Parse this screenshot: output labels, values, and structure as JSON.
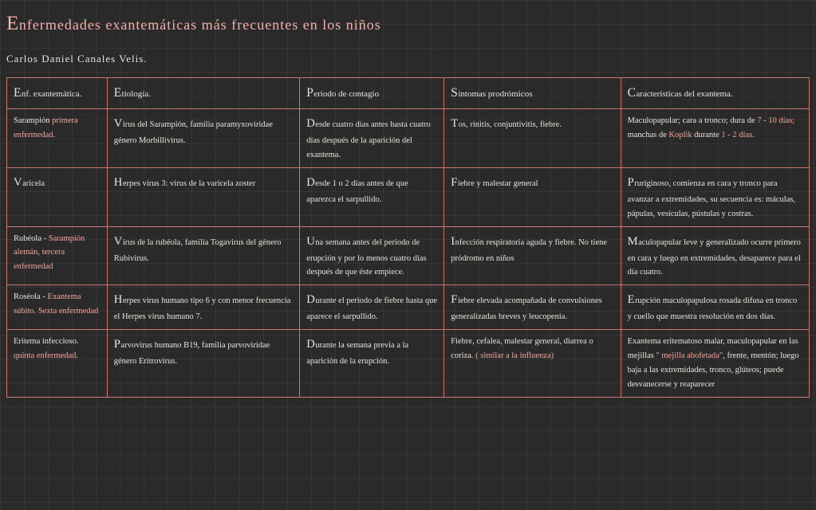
{
  "title": "Enfermedades exantemáticas más frecuentes en los niños",
  "author": "Carlos Daniel Canales Velis.",
  "headers": {
    "c0": "Enf. exantemática.",
    "c1": "Etiología.",
    "c2": "Periodo de contagio",
    "c3": "Síntomas prodrómicos",
    "c4": "Características del exantema."
  },
  "rows": [
    {
      "c0_a": "Sarampión ",
      "c0_b": "primera enfermedad.",
      "c1": "Virus del Sarampión, familia paramyxoviridae género Morbillivirus.",
      "c2": "Desde cuatro días antes hasta cuatro días después de la aparición del exantema.",
      "c3": "Tos, rinitis, conjuntivitis, fiebre.",
      "c4_a": "Maculopapular; cara a tronco; dura de ",
      "c4_b": "7 - 10 días; ",
      "c4_c": "manchas de ",
      "c4_d": "Koplik ",
      "c4_e": "durante ",
      "c4_f": "1 - 2 días."
    },
    {
      "c0": "Varicela",
      "c1": "Herpes virus 3: virus de la varicela zoster",
      "c2": "Desde 1 o 2 días antes de que aparezca el sarpullido.",
      "c3": "Fiebre y malestar general",
      "c4": "Pruriginoso, comienza en cara y tronco para avanzar a extremidades, su secuencia es: máculas, pápulas, vesículas, pústulas y costras."
    },
    {
      "c0_a": "Rubéola - ",
      "c0_b": "Sarampión alemán, tercera enfermedad",
      "c1": "Virus de la rubéola, familia Togavirus del género Rubivirus.",
      "c2": "Una semana antes del periodo de erupción y por lo menos cuatro días después de que éste empiece.",
      "c3": "Infección respiratoria aguda y fiebre. No tiene pródromo en niños",
      "c4": "Maculopapular leve y generalizado ocurre primero en cara y luego en extremidades, desaparece para el día cuatro."
    },
    {
      "c0_a": "Roséola - ",
      "c0_b": "Exantema súbito. Sexta enfermedad",
      "c1": "Herpes virus humano tipo 6 y con menor frecuencia el Herpes virus humano 7.",
      "c2": "Durante el periodo de fiebre hasta que aparece el sarpullido.",
      "c3": "Fiebre elevada acompañada de convulsiones generalizadas breves y leucopenia.",
      "c4": "Erupción maculopapulosa rosada difusa en tronco y cuello que muestra resolución en dos días."
    },
    {
      "c0_a": "Eritema infeccioso. ",
      "c0_b": "quinta enfermedad.",
      "c1": "Parvovirus humano B19, familia parvoviridae género Eritrovirus.",
      "c2": "Durante la semana previa a la aparición de la erupción.",
      "c3_a": "Fiebre, cefalea, malestar general, diarrea o coriza. ",
      "c3_b": "( similar a la influenza)",
      "c4_a": "Exantema eritematoso malar, maculopapular en las mejillas ",
      "c4_b": "\" mejilla abofetada\"",
      "c4_c": ", frente, mentón; luego baja a las extremidades, tronco, glúteos; puede desvanecerse y reaparecer"
    }
  ]
}
